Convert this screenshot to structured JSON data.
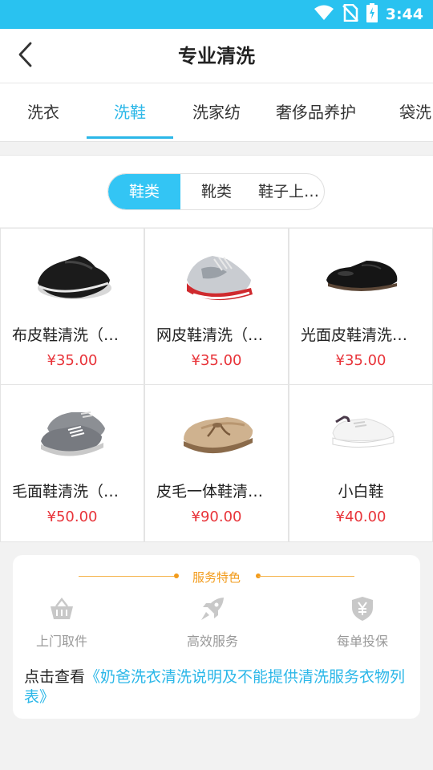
{
  "status_bar": {
    "time": "3:44",
    "icons": [
      "wifi-icon",
      "no-sim-icon",
      "battery-charging-icon"
    ]
  },
  "header": {
    "title": "专业清洗",
    "back_icon": "back-chevron-icon"
  },
  "tabs": [
    {
      "label": "洗衣",
      "active": false
    },
    {
      "label": "洗鞋",
      "active": true
    },
    {
      "label": "洗家纺",
      "active": false
    },
    {
      "label": "奢侈品养护",
      "active": false
    },
    {
      "label": "袋洗",
      "active": false
    }
  ],
  "segments": [
    {
      "label": "鞋类",
      "active": true
    },
    {
      "label": "靴类",
      "active": false
    },
    {
      "label": "鞋子上…",
      "active": false
    }
  ],
  "products": [
    {
      "name": "布皮鞋清洗（…",
      "price": "¥35.00",
      "image": "cloth-shoe-image"
    },
    {
      "name": "网皮鞋清洗（…",
      "price": "¥35.00",
      "image": "mesh-sneaker-image"
    },
    {
      "name": "光面皮鞋清洗…",
      "price": "¥35.00",
      "image": "leather-shoe-image"
    },
    {
      "name": "毛面鞋清洗（…",
      "price": "¥50.00",
      "image": "suede-shoe-image"
    },
    {
      "name": "皮毛一体鞋清…",
      "price": "¥90.00",
      "image": "fur-moccasin-image"
    },
    {
      "name": "小白鞋",
      "price": "¥40.00",
      "image": "white-sneaker-image"
    }
  ],
  "service": {
    "title": "服务特色",
    "features": [
      {
        "label": "上门取件",
        "icon": "basket-icon"
      },
      {
        "label": "高效服务",
        "icon": "rocket-icon"
      },
      {
        "label": "每单投保",
        "icon": "yen-shield-icon"
      }
    ],
    "note_prefix": "点击查看",
    "note_link": "《奶爸洗衣清洗说明及不能提供清洗服务衣物列表》"
  },
  "colors": {
    "accent": "#2bb7e8",
    "status_bar": "#29c2f0",
    "price": "#e8343a",
    "service_title": "#f29b1b"
  }
}
